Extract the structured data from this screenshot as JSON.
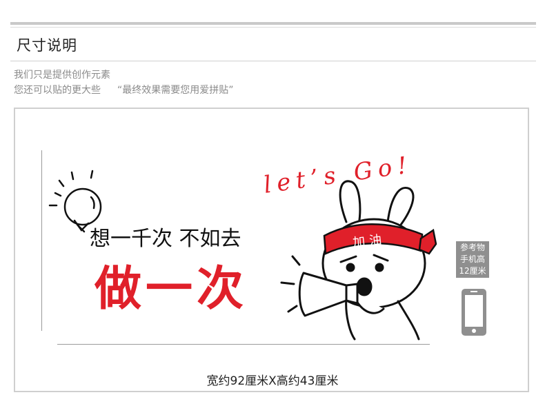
{
  "section": {
    "title": "尺寸说明"
  },
  "notes": {
    "line1": "我们只是提供创作元素",
    "line2_lead": "您还可以贴的更大些",
    "line2_quote": "“最终效果需要您用爱拼贴”"
  },
  "artwork": {
    "small_text": "想一千次 不如去",
    "big_text": "做一次",
    "lets_go": "let’s Go!",
    "headband_text": "加油",
    "colors": {
      "red": "#e0202a",
      "ink": "#111111"
    }
  },
  "reference": {
    "label_lines": [
      "参考物",
      "手机高",
      "12厘米"
    ]
  },
  "dimensions": {
    "caption": "宽约92厘米X高约43厘米"
  }
}
